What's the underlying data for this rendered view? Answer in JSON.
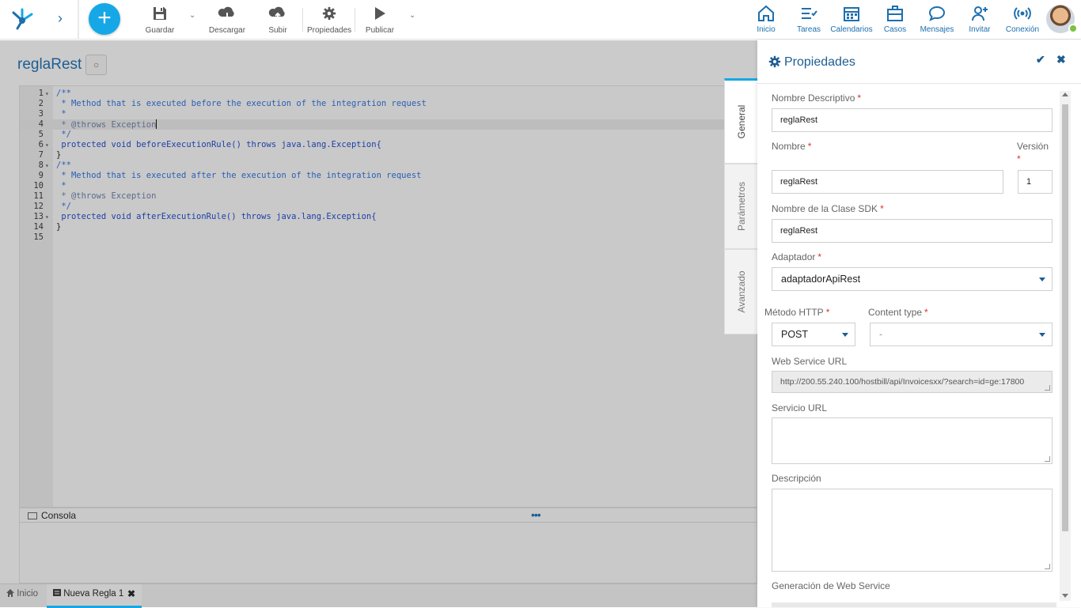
{
  "toolbar": {
    "save": "Guardar",
    "download": "Descargar",
    "upload": "Subir",
    "properties": "Propiedades",
    "publish": "Publicar",
    "add_label": "+",
    "expand_label": "›"
  },
  "nav": [
    {
      "label": "Inicio",
      "icon": "home-icon"
    },
    {
      "label": "Tareas",
      "icon": "tasks-icon"
    },
    {
      "label": "Calendarios",
      "icon": "calendar-icon"
    },
    {
      "label": "Casos",
      "icon": "briefcase-icon"
    },
    {
      "label": "Mensajes",
      "icon": "chat-icon"
    },
    {
      "label": "Invitar",
      "icon": "invite-user-icon"
    },
    {
      "label": "Conexión",
      "icon": "broadcast-icon"
    }
  ],
  "colors": {
    "accent": "#16a8e6",
    "brand": "#1d5e92",
    "required": "#d9342b",
    "online": "#7cc142"
  },
  "page": {
    "title": "reglaRest",
    "title_button": "○"
  },
  "editor": {
    "lines": [
      {
        "n": "1",
        "fold": "▾",
        "text": "/**",
        "cls": "c-com"
      },
      {
        "n": "2",
        "fold": "",
        "text": " * Method that is executed before the execution of the integration request",
        "cls": "c-com"
      },
      {
        "n": "3",
        "fold": "",
        "text": " *",
        "cls": "c-com"
      },
      {
        "n": "4",
        "fold": "",
        "text": " * @throws Exception",
        "cls": "c-tag",
        "active": true
      },
      {
        "n": "5",
        "fold": "",
        "text": " */",
        "cls": "c-com"
      },
      {
        "n": "6",
        "fold": "▾",
        "text": " protected void beforeExecutionRule() throws java.lang.Exception{",
        "cls": "c-kw"
      },
      {
        "n": "7",
        "fold": "",
        "text": "}",
        "cls": "c-plain"
      },
      {
        "n": "8",
        "fold": "▾",
        "text": "/**",
        "cls": "c-com"
      },
      {
        "n": "9",
        "fold": "",
        "text": " * Method that is executed after the execution of the integration request",
        "cls": "c-com"
      },
      {
        "n": "10",
        "fold": "",
        "text": " *",
        "cls": "c-com"
      },
      {
        "n": "11",
        "fold": "",
        "text": " * @throws Exception",
        "cls": "c-tag"
      },
      {
        "n": "12",
        "fold": "",
        "text": " */",
        "cls": "c-com"
      },
      {
        "n": "13",
        "fold": "▾",
        "text": " protected void afterExecutionRule() throws java.lang.Exception{",
        "cls": "c-kw"
      },
      {
        "n": "14",
        "fold": "",
        "text": "}",
        "cls": "c-plain"
      },
      {
        "n": "15",
        "fold": "",
        "text": "",
        "cls": "c-plain"
      }
    ]
  },
  "console": {
    "label": "Consola",
    "menu": "•••"
  },
  "bottom_tabs": {
    "home": "Inicio",
    "rule": "Nueva Regla 1",
    "close": "✖"
  },
  "panel": {
    "title": "Propiedades",
    "ok": "✔",
    "close": "✖",
    "tabs": [
      "General",
      "Parámetros",
      "Avanzado"
    ],
    "fields": {
      "descriptive_name": {
        "label": "Nombre Descriptivo",
        "value": "reglaRest"
      },
      "name": {
        "label": "Nombre",
        "value": "reglaRest"
      },
      "version": {
        "label": "Versión",
        "value": "1"
      },
      "sdk_class": {
        "label": "Nombre de la Clase SDK",
        "value": "reglaRest"
      },
      "adapter": {
        "label": "Adaptador",
        "value": "adaptadorApiRest"
      },
      "http_method": {
        "label": "Método HTTP",
        "value": "POST"
      },
      "content_type": {
        "label": "Content type",
        "value": "-"
      },
      "ws_url": {
        "label": "Web Service URL",
        "value": "http://200.55.240.100/hostbill/api/Invoicesxx/?search=id=ge:17800"
      },
      "service_url": {
        "label": "Servicio URL",
        "value": ""
      },
      "description": {
        "label": "Descripción",
        "value": ""
      },
      "ws_generation": {
        "label": "Generación de Web Service"
      }
    },
    "required_mark": "*"
  }
}
